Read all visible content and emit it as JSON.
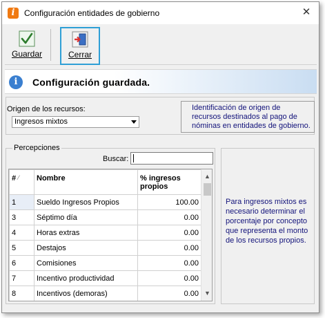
{
  "window": {
    "title": "Configuración entidades de gobierno",
    "app_icon_letter": "i",
    "close_glyph": "✕"
  },
  "toolbar": {
    "save_label": "Guardar",
    "close_label": "Cerrar",
    "save_icon": "checkmark-icon",
    "close_icon": "exit-door-icon"
  },
  "info": {
    "icon": "info-icon",
    "message": "Configuración guardada."
  },
  "origin": {
    "label": "Origen de los recursos:",
    "selected": "Ingresos mixtos",
    "note": "Identificación de origen de recursos destinados al pago de nóminas en entidades de gobierno."
  },
  "percepciones": {
    "group_title": "Percepciones",
    "search_label": "Buscar:",
    "search_value": "",
    "columns": {
      "idx": "#",
      "name": "Nombre",
      "pct": "% ingresos propios"
    },
    "rows": [
      {
        "idx": "1",
        "name": "Sueldo Ingresos Propios",
        "pct": "100.00"
      },
      {
        "idx": "3",
        "name": "Séptimo día",
        "pct": "0.00"
      },
      {
        "idx": "4",
        "name": "Horas extras",
        "pct": "0.00"
      },
      {
        "idx": "5",
        "name": "Destajos",
        "pct": "0.00"
      },
      {
        "idx": "6",
        "name": "Comisiones",
        "pct": "0.00"
      },
      {
        "idx": "7",
        "name": "Incentivo productividad",
        "pct": "0.00"
      },
      {
        "idx": "8",
        "name": "Incentivos (demoras)",
        "pct": "0.00"
      }
    ]
  },
  "side_note": "Para ingresos mixtos es necesario determinar el porcentaje por concepto que representa el monto de los recursos propios.",
  "colors": {
    "accent_highlight": "#2e9fd6",
    "note_text": "#12127a",
    "info_icon": "#3a7fd0",
    "app_icon": "#f07a12"
  }
}
